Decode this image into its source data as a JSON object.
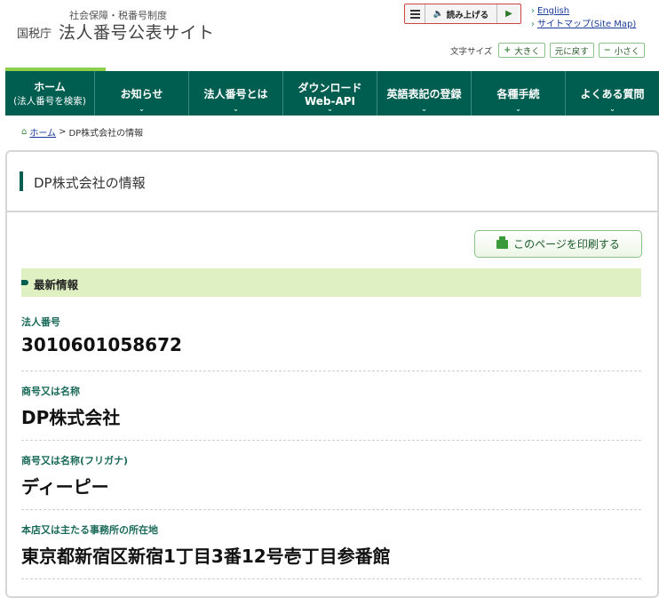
{
  "header": {
    "site_sub": "社会保障・税番号制度",
    "agency": "国税庁",
    "site_title": "法人番号公表サイト",
    "reader": {
      "label": "読み上げる"
    },
    "links": [
      "English",
      "サイトマップ(Site Map)"
    ],
    "font_size": {
      "label": "文字サイズ",
      "larger": "大きく",
      "reset": "元に戻す",
      "smaller": "小さく"
    }
  },
  "nav": [
    {
      "line1": "ホーム",
      "line2": "(法人番号を検索)"
    },
    {
      "line1": "お知らせ",
      "line2": ""
    },
    {
      "line1": "法人番号とは",
      "line2": ""
    },
    {
      "line1": "ダウンロード",
      "line2": "Web-API"
    },
    {
      "line1": "英語表記の登録",
      "line2": ""
    },
    {
      "line1": "各種手続",
      "line2": ""
    },
    {
      "line1": "よくある質問",
      "line2": ""
    }
  ],
  "breadcrumb": {
    "home": "ホーム",
    "separator": ">",
    "current": "DP株式会社の情報"
  },
  "page": {
    "title": "DP株式会社の情報",
    "print_label": "このページを印刷する",
    "section": "最新情報",
    "fields": [
      {
        "label": "法人番号",
        "value": "3010601058672"
      },
      {
        "label": "商号又は名称",
        "value": "DP株式会社"
      },
      {
        "label": "商号又は名称(フリガナ)",
        "value": "ディーピー"
      },
      {
        "label": "本店又は主たる事務所の所在地",
        "value": "東京都新宿区新宿1丁目3番12号壱丁目参番館"
      }
    ]
  },
  "colors": {
    "nav_bg": "#005e51",
    "accent": "#8ccf4a",
    "section_bg": "#dff0c2"
  }
}
